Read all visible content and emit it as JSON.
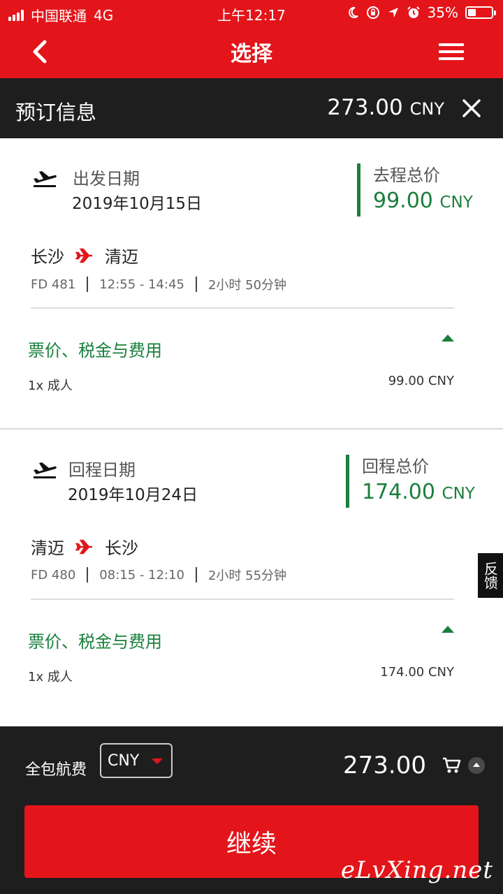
{
  "status_bar": {
    "carrier": "中国联通",
    "network": "4G",
    "time": "上午12:17",
    "battery": "35%",
    "battery_level": 0.35
  },
  "nav": {
    "title": "选择"
  },
  "booking": {
    "label": "预订信息",
    "total_amount": "273.00",
    "total_currency": "CNY"
  },
  "outbound": {
    "date_label": "出发日期",
    "date": "2019年10月15日",
    "price_label": "去程总价",
    "price": "99.00",
    "currency": "CNY",
    "from": "长沙",
    "to": "清迈",
    "flight_no": "FD 481",
    "times": "12:55 - 14:45",
    "duration": "2小时 50分钟",
    "fees_label": "票价、税金与费用",
    "pax": "1x 成人",
    "pax_price": "99.00 CNY"
  },
  "return": {
    "date_label": "回程日期",
    "date": "2019年10月24日",
    "price_label": "回程总价",
    "price": "174.00",
    "currency": "CNY",
    "from": "清迈",
    "to": "长沙",
    "flight_no": "FD 480",
    "times": "08:15 - 12:10",
    "duration": "2小时 55分钟",
    "fees_label": "票价、税金与费用",
    "pax": "1x 成人",
    "pax_price": "174.00 CNY"
  },
  "feedback": "反馈",
  "footer": {
    "package_label": "全包航费",
    "currency_selected": "CNY",
    "amount": "273.00",
    "continue_label": "继续"
  },
  "watermark": "eLvXing.net",
  "colors": {
    "brand_red": "#e3151a",
    "green": "#1a7f3c",
    "dark": "#1e1e1e"
  }
}
